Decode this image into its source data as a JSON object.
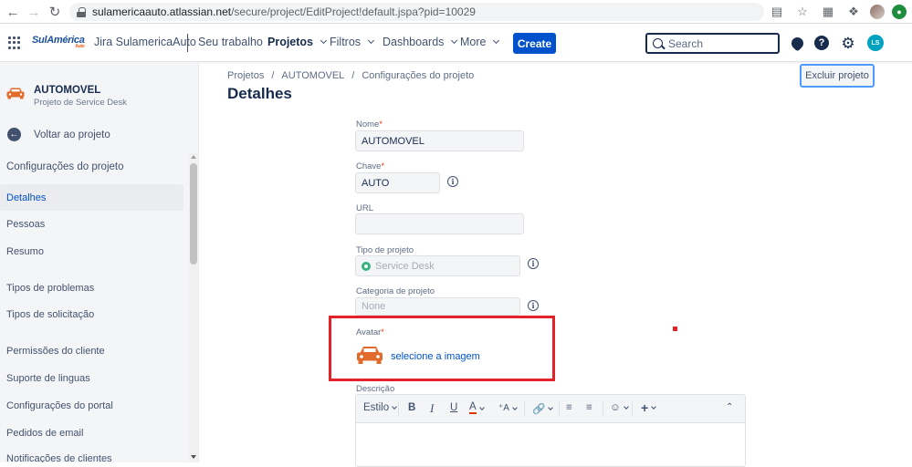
{
  "browser": {
    "url_host": "sulamericaauto.atlassian.net",
    "url_path": "/secure/project/EditProject!default.jspa?pid=10029"
  },
  "topnav": {
    "logo_text": "SulAmérica",
    "logo_sub": "Auto",
    "site_name": "Jira SulamericaAuto",
    "items": [
      "Seu trabalho",
      "Projetos",
      "Filtros",
      "Dashboards",
      "More"
    ],
    "create_label": "Create",
    "search_placeholder": "Search",
    "avatar_initials": "LS"
  },
  "sidebar": {
    "project_name": "AUTOMOVEL",
    "project_type": "Projeto de Service Desk",
    "back_label": "Voltar ao projeto",
    "section_title": "Configurações do projeto",
    "items": [
      {
        "label": "Detalhes",
        "active": true
      },
      {
        "label": "Pessoas",
        "active": false
      },
      {
        "label": "Resumo",
        "active": false
      },
      {
        "label": "Tipos de problemas",
        "active": false
      },
      {
        "label": "Tipos de solicitação",
        "active": false
      },
      {
        "label": "Permissões do cliente",
        "active": false
      },
      {
        "label": "Suporte de linguas",
        "active": false
      },
      {
        "label": "Configurações do portal",
        "active": false
      },
      {
        "label": "Pedidos de email",
        "active": false
      },
      {
        "label": "Notificações de clientes",
        "active": false
      }
    ]
  },
  "main": {
    "breadcrumb": [
      "Projetos",
      "/",
      "AUTOMOVEL",
      "/",
      "Configurações do projeto"
    ],
    "title": "Detalhes",
    "delete_label": "Excluir projeto",
    "form": {
      "name_label": "Nome",
      "name_value": "AUTOMOVEL",
      "key_label": "Chave",
      "key_value": "AUTO",
      "url_label": "URL",
      "url_value": "",
      "type_label": "Tipo de projeto",
      "type_value": "Service Desk",
      "category_label": "Categoria de projeto",
      "category_value": "None",
      "avatar_label": "Avatar",
      "avatar_link": "selecione a imagem",
      "description_label": "Descrição"
    },
    "editor": {
      "style_label": "Estilo"
    }
  },
  "colors": {
    "primary": "#0052cc",
    "highlight": "#e2232a",
    "car_icon": "#e06b2d"
  }
}
